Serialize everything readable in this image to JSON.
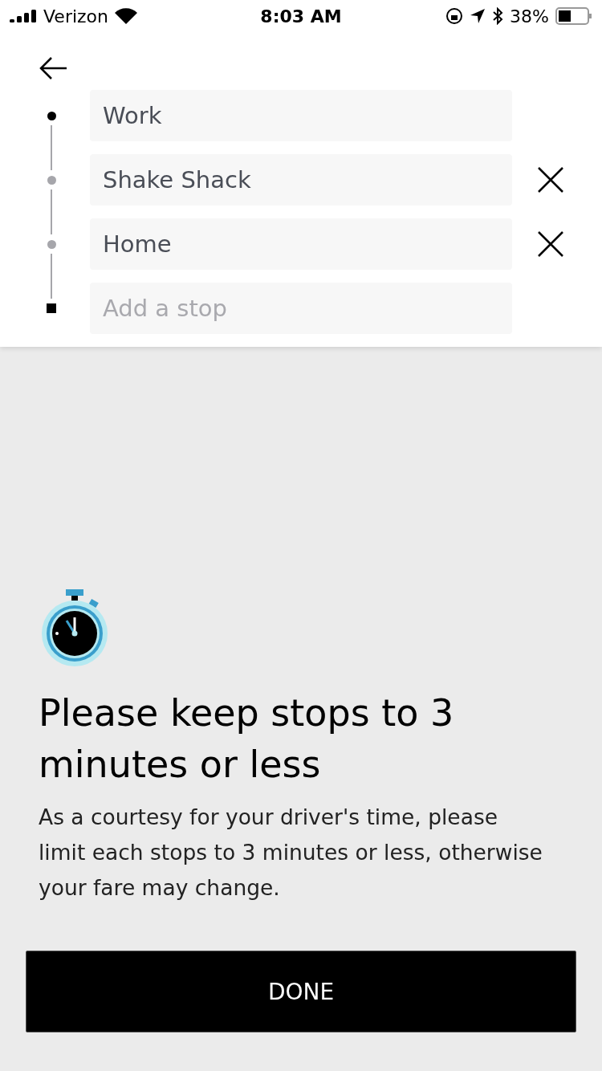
{
  "status_bar": {
    "carrier": "Verizon",
    "time": "8:03 AM",
    "battery": "38%"
  },
  "stops": [
    {
      "kind": "start",
      "value": "Work",
      "removable": false
    },
    {
      "kind": "stop",
      "value": "Shake Shack",
      "removable": true
    },
    {
      "kind": "stop",
      "value": "Home",
      "removable": true
    },
    {
      "kind": "end",
      "placeholder": "Add a stop",
      "removable": false
    }
  ],
  "notice": {
    "title": "Please keep stops to 3 minutes or less",
    "body": "As a courtesy for your driver's time, please limit each stops to 3 minutes or less, otherwise your fare may change."
  },
  "button": "DONE"
}
